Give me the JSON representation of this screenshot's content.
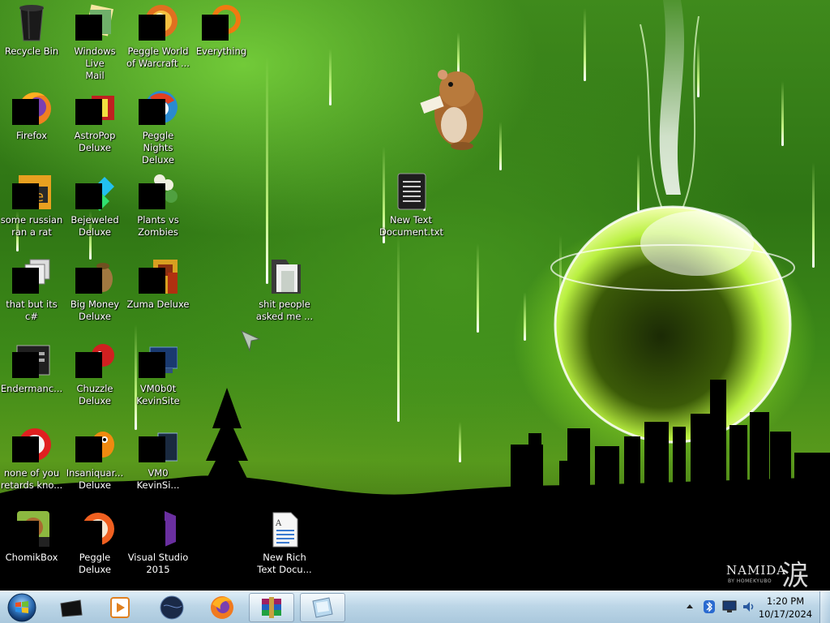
{
  "desktop": {
    "icons": [
      {
        "name": "Recycle Bin",
        "icon": "recycle-bin-icon"
      },
      {
        "name": "Windows Live\nMail",
        "icon": "mail-icon"
      },
      {
        "name": "Peggle World\nof Warcraft ...",
        "icon": "peggle-icon"
      },
      {
        "name": "Everything",
        "icon": "everything-search-icon"
      },
      {
        "name": "Firefox",
        "icon": "firefox-icon"
      },
      {
        "name": "AstroPop\nDeluxe",
        "icon": "astropop-icon"
      },
      {
        "name": "Peggle Nights\nDeluxe",
        "icon": "peggle-nights-icon"
      },
      {
        "name": "some russian\nran a rat",
        "icon": "shortcut-icon"
      },
      {
        "name": "Bejeweled\nDeluxe",
        "icon": "bejeweled-icon"
      },
      {
        "name": "Plants vs\nZombies",
        "icon": "plants-vs-zombies-icon"
      },
      {
        "name": "New Text\nDocument.txt",
        "icon": "text-file-icon"
      },
      {
        "name": "that but its c#",
        "icon": "shortcut-icon"
      },
      {
        "name": "Big Money\nDeluxe",
        "icon": "big-money-icon"
      },
      {
        "name": "Zuma Deluxe",
        "icon": "zuma-icon"
      },
      {
        "name": "shit people\nasked me ...",
        "icon": "folder-icon"
      },
      {
        "name": "Endermanc...",
        "icon": "app-window-icon"
      },
      {
        "name": "Chuzzle\nDeluxe",
        "icon": "chuzzle-icon"
      },
      {
        "name": "VM0b0t\nKevinSite",
        "icon": "vm-icon"
      },
      {
        "name": "none of you\nretards kno...",
        "icon": "shortcut-icon"
      },
      {
        "name": "Insaniquar...\nDeluxe",
        "icon": "insaniquarium-icon"
      },
      {
        "name": "VM0\nKevinSi...",
        "icon": "vm-icon"
      },
      {
        "name": "ChomikBox",
        "icon": "chomikbox-icon"
      },
      {
        "name": "Peggle Deluxe",
        "icon": "peggle-icon"
      },
      {
        "name": "Visual Studio\n2015",
        "icon": "visual-studio-icon"
      },
      {
        "name": "New Rich\nText Docu...",
        "icon": "rich-text-file-icon"
      }
    ]
  },
  "wallpaper": {
    "brand": "NAMIDA",
    "brand_sub": "BY HOMEKYUBO",
    "kanji": "涙"
  },
  "taskbar": {
    "start_icon": "windows-start-orb",
    "pinned": [
      {
        "icon": "black-app-icon"
      },
      {
        "icon": "media-player-icon"
      },
      {
        "icon": "dark-globe-icon"
      },
      {
        "icon": "firefox-icon"
      },
      {
        "icon": "winrar-icon",
        "active": true
      },
      {
        "icon": "glass-window-icon",
        "active": true
      }
    ],
    "clock": {
      "time": "1:20 PM",
      "date": "10/17/2024"
    }
  }
}
